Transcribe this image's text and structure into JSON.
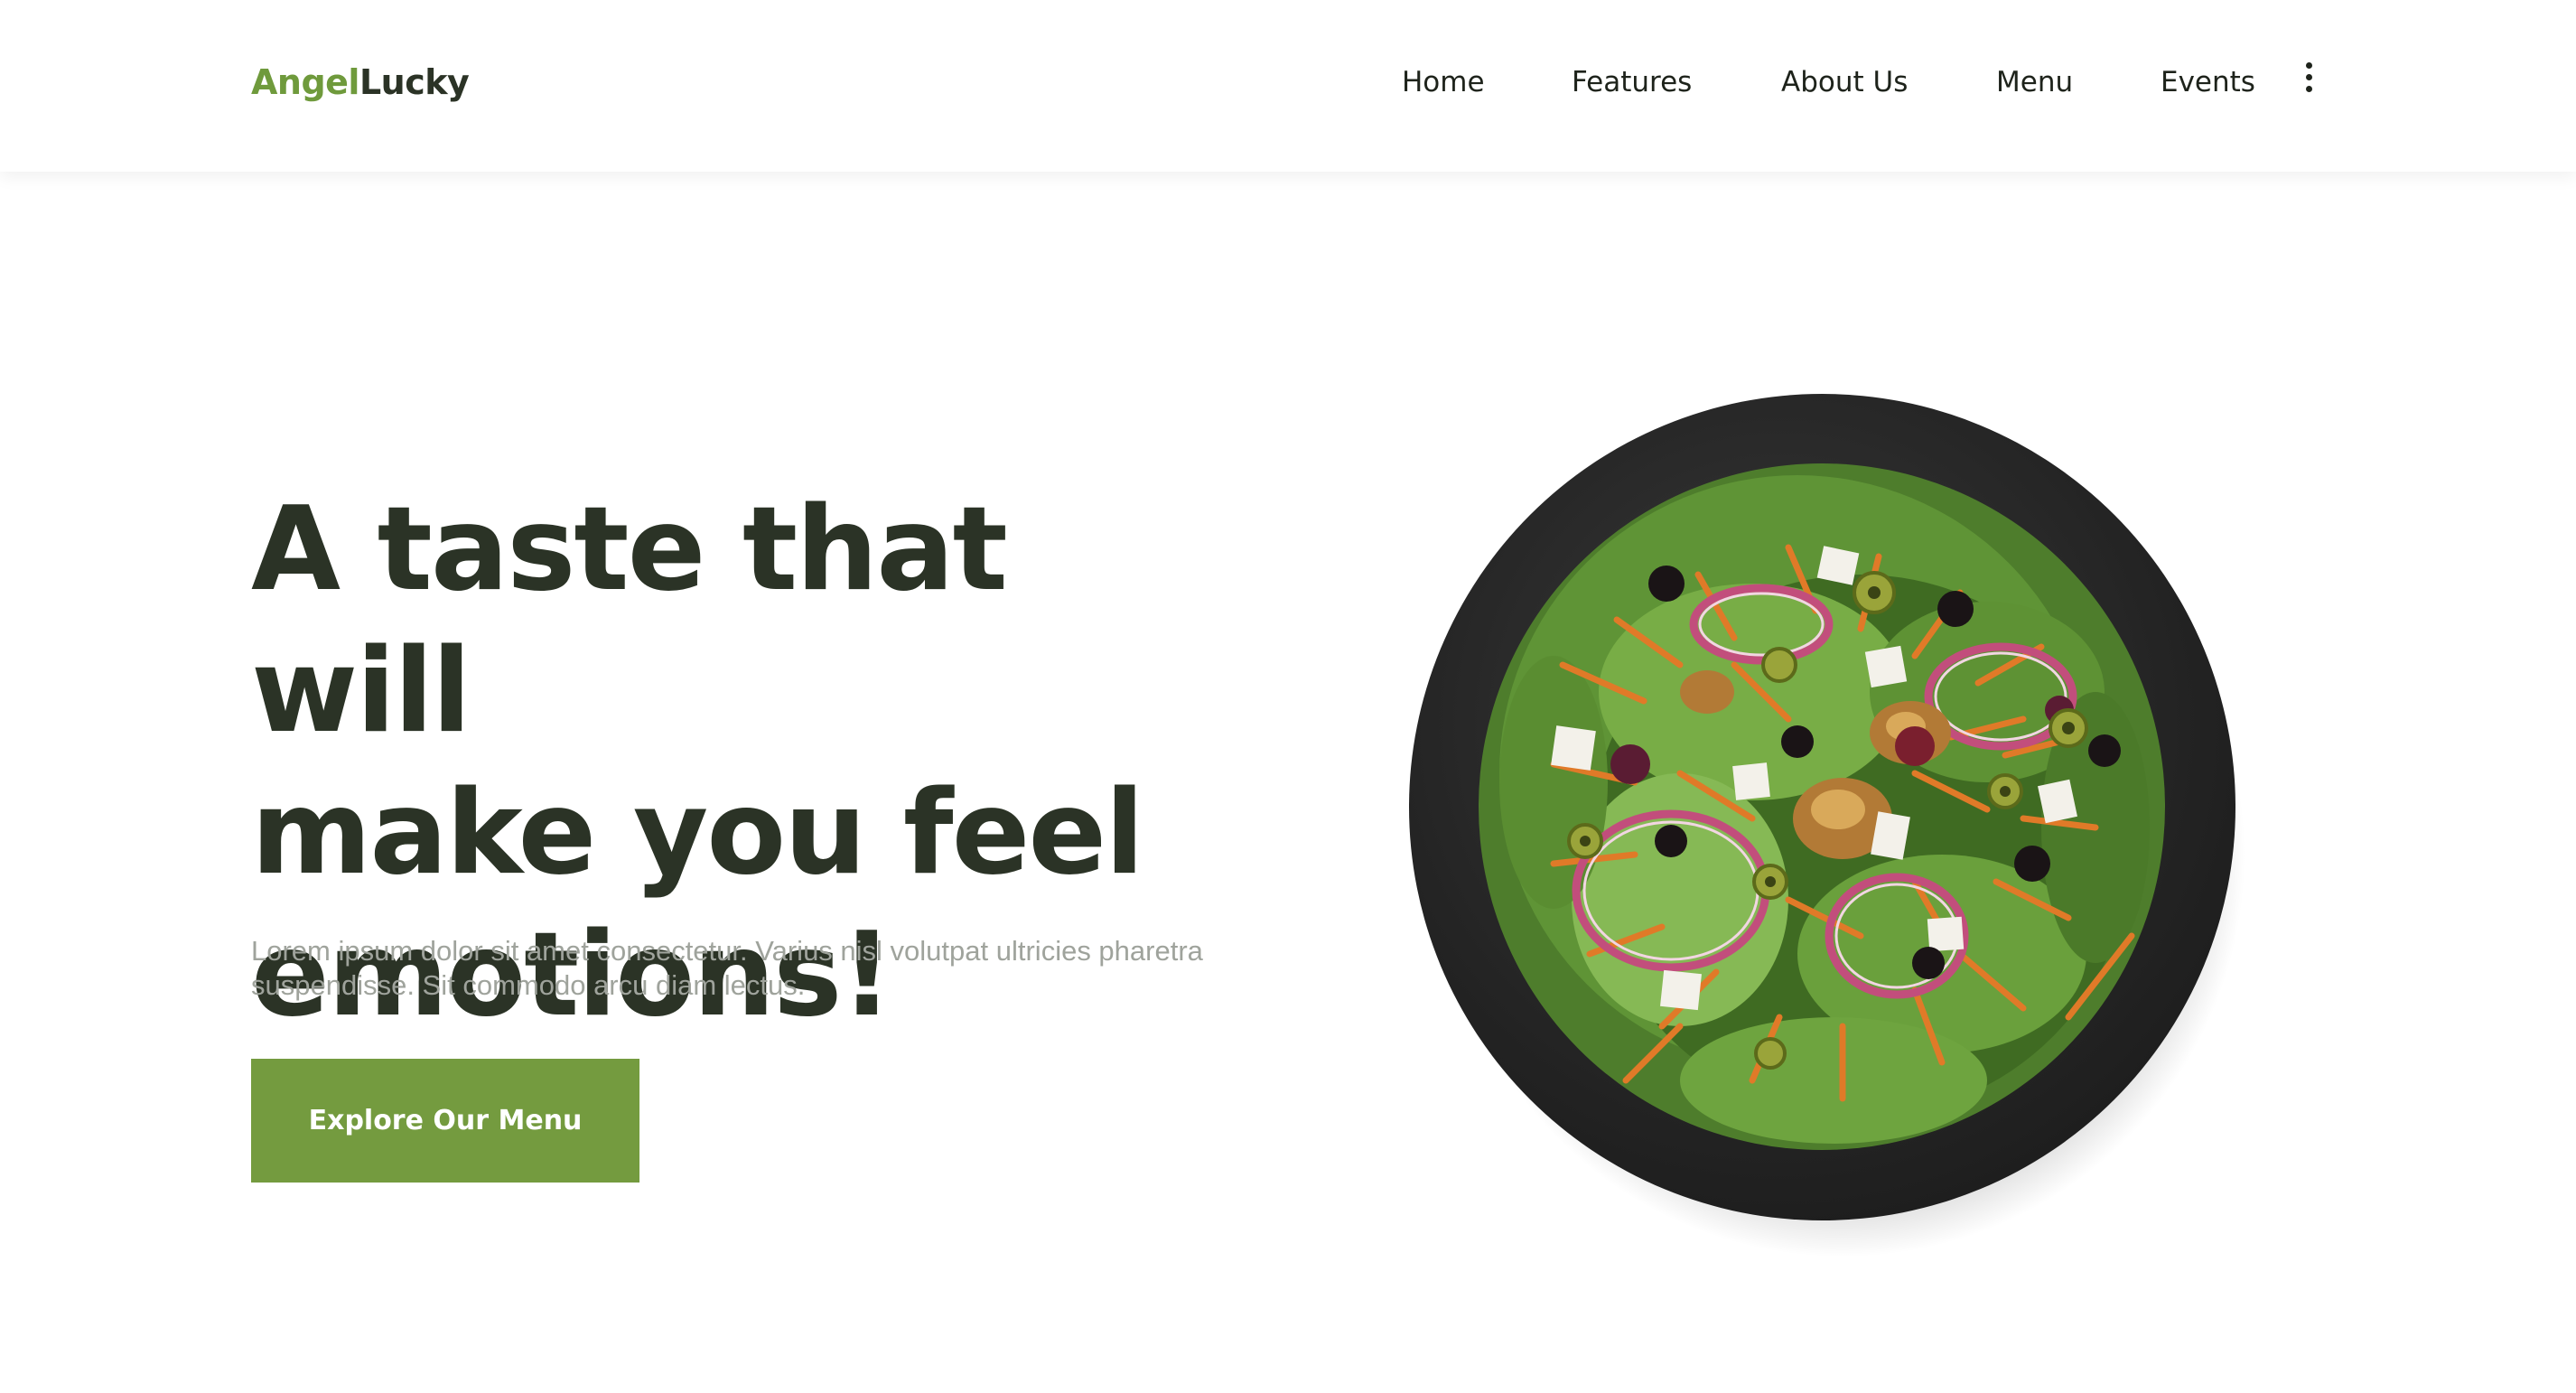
{
  "header": {
    "logo": {
      "part1": "Angel",
      "part2": "Lucky"
    },
    "nav": [
      {
        "label": "Home",
        "icon": ""
      },
      {
        "label": "Features"
      },
      {
        "label": "About Us"
      },
      {
        "label": "Menu"
      },
      {
        "label": "Events"
      }
    ],
    "more_icon": "kebab-menu-icon"
  },
  "hero": {
    "title_lines": [
      "A taste that will",
      "make you feel",
      "emotions!"
    ],
    "description": "Lorem ipsum dolor sit amet consectetur. Varius nisl volutpat ultricies pharetra suspendisse. Sit commodo arcu diam lectus.",
    "cta_label": "Explore Our Menu"
  },
  "colors": {
    "brand_green": "#749b3f",
    "heading_dark": "#2b3326",
    "muted_text": "#9fa39c"
  }
}
